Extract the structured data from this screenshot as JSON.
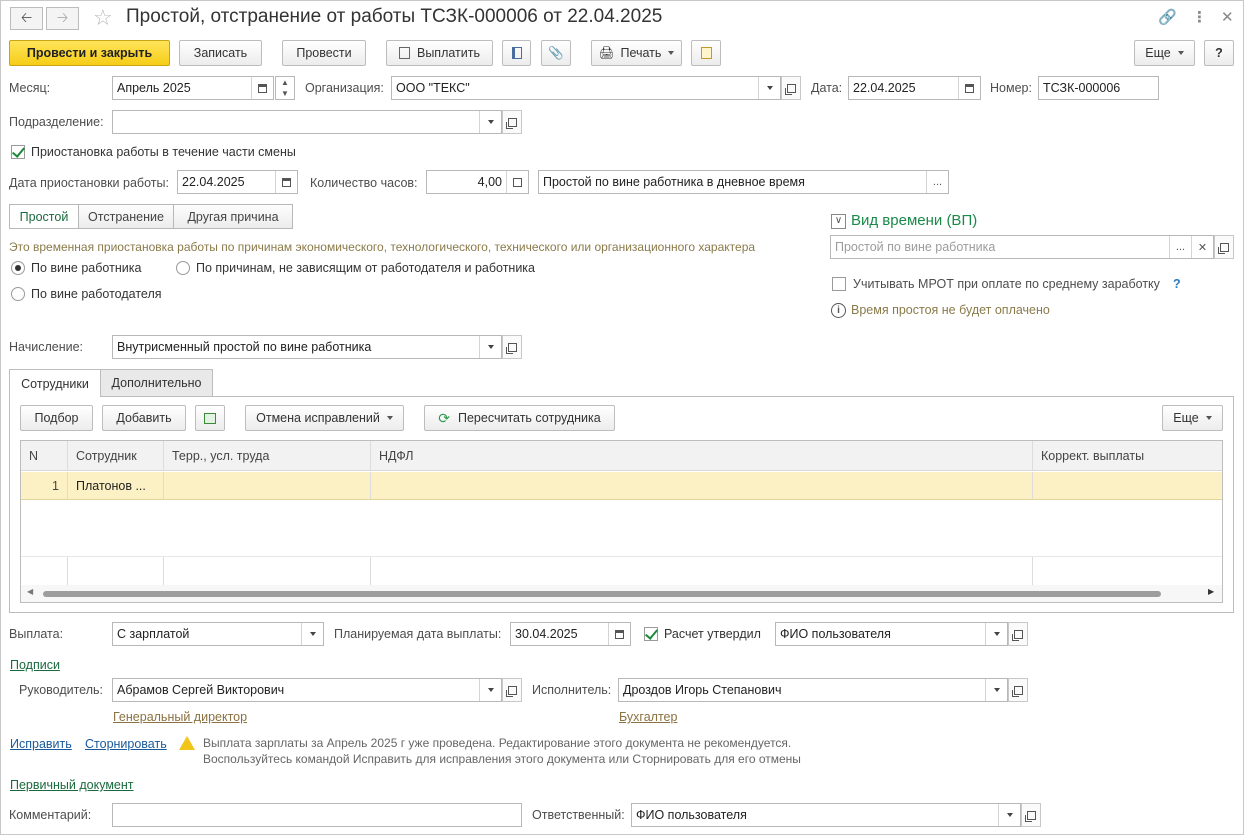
{
  "window": {
    "title": "Простой, отстранение от работы ТСЗК-000006 от 22.04.2025"
  },
  "toolbar": {
    "post_close": "Провести и закрыть",
    "save": "Записать",
    "post": "Провести",
    "pay": "Выплатить",
    "print": "Печать",
    "more": "Еще",
    "help": "?"
  },
  "header": {
    "month_label": "Месяц:",
    "month_value": "Апрель 2025",
    "org_label": "Организация:",
    "org_value": "ООО \"ТЕКС\"",
    "date_label": "Дата:",
    "date_value": "22.04.2025",
    "number_label": "Номер:",
    "number_value": "ТСЗК-000006",
    "division_label": "Подразделение:",
    "division_value": ""
  },
  "suspension": {
    "partial_shift_label": "Приостановка работы в течение части смены",
    "partial_shift_checked": true,
    "date_label": "Дата приостановки работы:",
    "date_value": "22.04.2025",
    "hours_label": "Количество часов:",
    "hours_value": "4,00",
    "type_value": "Простой по вине работника в дневное время"
  },
  "reason_tabs": [
    "Простой",
    "Отстранение",
    "Другая причина"
  ],
  "reason": {
    "description": "Это временная приостановка работы по причинам экономического, технологического, технического или организационного характера",
    "options": [
      "По вине работника",
      "По причинам, не зависящим от работодателя и работника",
      "По вине работодателя"
    ],
    "selected": "По вине работника"
  },
  "time_type": {
    "title": "Вид времени (ВП)",
    "placeholder": "Простой по вине работника",
    "mrot_label": "Учитывать МРОТ при оплате по среднему заработку",
    "mrot_help": "?",
    "info": "Время простоя не будет оплачено"
  },
  "accrual": {
    "label": "Начисление:",
    "value": "Внутрисменный простой по вине работника"
  },
  "page_tabs": [
    "Сотрудники",
    "Дополнительно"
  ],
  "employees_toolbar": {
    "pick": "Подбор",
    "add": "Добавить",
    "cancel_corrections": "Отмена исправлений",
    "recalc": "Пересчитать сотрудника",
    "more": "Еще"
  },
  "table": {
    "columns": [
      "N",
      "Сотрудник",
      "Терр., усл. труда",
      "НДФЛ",
      "Коррект. выплаты"
    ],
    "rows": [
      [
        "1",
        "Платонов ...",
        "",
        "",
        ""
      ]
    ]
  },
  "payment": {
    "label": "Выплата:",
    "value": "С зарплатой",
    "planned_label": "Планируемая дата выплаты:",
    "planned_value": "30.04.2025",
    "approved_label": "Расчет утвердил",
    "approved_checked": true,
    "approved_value": "ФИО пользователя"
  },
  "signatures": {
    "link": "Подписи",
    "head_label": "Руководитель:",
    "head_value": "Абрамов Сергей Викторович",
    "head_position": "Генеральный директор",
    "executor_label": "Исполнитель:",
    "executor_value": "Дроздов Игорь Степанович",
    "executor_position": "Бухгалтер"
  },
  "warning": {
    "fix_link": "Исправить",
    "storno_link": "Сторнировать",
    "line1": "Выплата зарплаты за Апрель 2025 г уже проведена. Редактирование этого документа не рекомендуется.",
    "line2": "Воспользуйтесь командой Исправить для исправления этого документа или Сторнировать для его отмены"
  },
  "footer": {
    "primary_doc_link": "Первичный документ",
    "comment_label": "Комментарий:",
    "comment_value": "",
    "responsible_label": "Ответственный:",
    "responsible_value": "ФИО пользователя"
  }
}
